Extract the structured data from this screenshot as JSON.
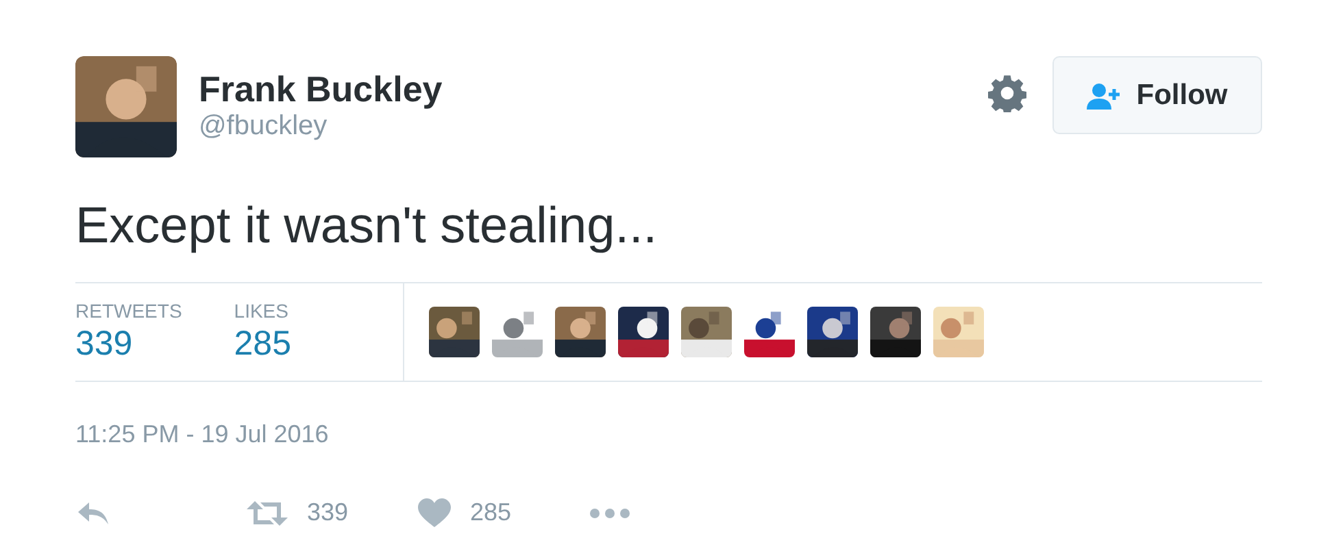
{
  "author": {
    "name": "Frank Buckley",
    "handle": "@fbuckley"
  },
  "follow_button": {
    "label": "Follow"
  },
  "tweet_text": "Except it wasn't stealing...",
  "stats": [
    {
      "label": "RETWEETS",
      "value": "339"
    },
    {
      "label": "LIKES",
      "value": "285"
    }
  ],
  "timestamp": "11:25 PM - 19 Jul 2016",
  "actions": [
    {
      "kind": "reply"
    },
    {
      "kind": "retweet",
      "count": "339"
    },
    {
      "kind": "like",
      "count": "285"
    },
    {
      "kind": "more"
    }
  ]
}
